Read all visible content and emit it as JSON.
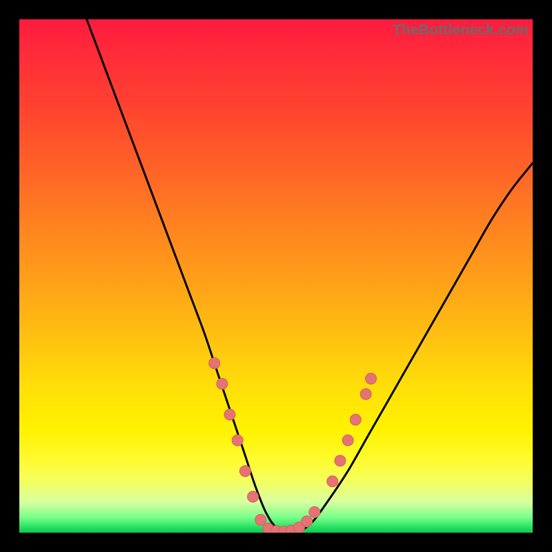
{
  "watermark": "TheBottleneck.com",
  "chart_data": {
    "type": "line",
    "title": "",
    "xlabel": "",
    "ylabel": "",
    "xlim": [
      0,
      100
    ],
    "ylim": [
      0,
      100
    ],
    "grid": false,
    "legend": false,
    "background_gradient": {
      "direction": "vertical",
      "stops": [
        {
          "pos": 0,
          "color": "#ff1a3f"
        },
        {
          "pos": 50,
          "color": "#ffa318"
        },
        {
          "pos": 80,
          "color": "#fff200"
        },
        {
          "pos": 100,
          "color": "#16c452"
        }
      ]
    },
    "series": [
      {
        "name": "bottleneck-curve",
        "color": "#000000",
        "x": [
          12,
          15,
          18,
          21,
          24,
          27,
          30,
          33,
          36,
          38,
          40,
          42,
          44,
          46,
          48,
          50,
          52,
          54,
          57,
          60,
          64,
          68,
          72,
          76,
          80,
          84,
          88,
          92,
          96,
          100
        ],
        "y": [
          103,
          95,
          87,
          79,
          71,
          63,
          55,
          47,
          39,
          33,
          27,
          21,
          15,
          9,
          4,
          1,
          0,
          0,
          2,
          6,
          12,
          19,
          26,
          33,
          40,
          47,
          54,
          61,
          67,
          72
        ]
      }
    ],
    "highlight_points": [
      {
        "x": 38,
        "y": 33
      },
      {
        "x": 39.5,
        "y": 29
      },
      {
        "x": 41,
        "y": 23
      },
      {
        "x": 42.5,
        "y": 18
      },
      {
        "x": 44,
        "y": 12
      },
      {
        "x": 45.5,
        "y": 7
      },
      {
        "x": 47,
        "y": 2.5
      },
      {
        "x": 48.5,
        "y": 0.8
      },
      {
        "x": 50,
        "y": 0.3
      },
      {
        "x": 51.5,
        "y": 0.2
      },
      {
        "x": 53,
        "y": 0.4
      },
      {
        "x": 54.5,
        "y": 1
      },
      {
        "x": 56,
        "y": 2.2
      },
      {
        "x": 57.5,
        "y": 4
      },
      {
        "x": 61,
        "y": 10
      },
      {
        "x": 62.5,
        "y": 14
      },
      {
        "x": 64,
        "y": 18
      },
      {
        "x": 65.5,
        "y": 22
      },
      {
        "x": 67.5,
        "y": 27
      },
      {
        "x": 68.5,
        "y": 30
      }
    ]
  }
}
